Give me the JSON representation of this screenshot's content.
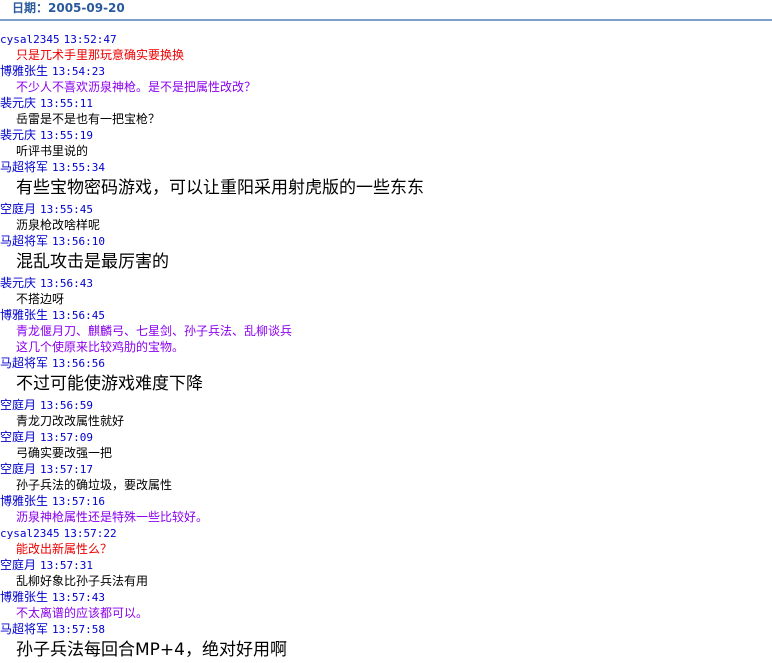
{
  "header": {
    "date_label": "日期：2005-09-20"
  },
  "colors": {
    "name": "#0000cc",
    "red": "#ee0000",
    "purple": "#8a00ee",
    "black": "#000000",
    "blue": "#0000ee"
  },
  "messages": [
    {
      "user": "cysal2345",
      "time": "13:52:47",
      "style": "red",
      "lines": [
        "只是兀术手里那玩意确实要换换"
      ]
    },
    {
      "user": "博雅张生",
      "time": "13:54:23",
      "style": "purple",
      "lines": [
        "不少人不喜欢沥泉神枪。是不是把属性改改？"
      ]
    },
    {
      "user": "裴元庆",
      "time": "13:55:11",
      "style": "black",
      "lines": [
        "岳雷是不是也有一把宝枪？"
      ]
    },
    {
      "user": "裴元庆",
      "time": "13:55:19",
      "style": "black",
      "lines": [
        "听评书里说的"
      ]
    },
    {
      "user": "马超将军",
      "time": "13:55:34",
      "style": "big",
      "lines": [
        "有些宝物密码游戏，可以让重阳采用射虎版的一些东东"
      ]
    },
    {
      "user": "空庭月",
      "time": "13:55:45",
      "style": "black",
      "lines": [
        "沥泉枪改啥样呢"
      ]
    },
    {
      "user": "马超将军",
      "time": "13:56:10",
      "style": "big",
      "lines": [
        "混乱攻击是最厉害的"
      ]
    },
    {
      "user": "裴元庆",
      "time": "13:56:43",
      "style": "black",
      "lines": [
        "不搭边呀"
      ]
    },
    {
      "user": "博雅张生",
      "time": "13:56:45",
      "style": "purple",
      "lines": [
        "青龙偃月刀、麒麟弓、七星剑、孙子兵法、乱柳谈兵",
        "这几个使原来比较鸡肋的宝物。"
      ]
    },
    {
      "user": "马超将军",
      "time": "13:56:56",
      "style": "big",
      "lines": [
        "不过可能使游戏难度下降"
      ]
    },
    {
      "user": "空庭月",
      "time": "13:56:59",
      "style": "black",
      "lines": [
        "青龙刀改改属性就好"
      ]
    },
    {
      "user": "空庭月",
      "time": "13:57:09",
      "style": "black",
      "lines": [
        "弓确实要改强一把"
      ]
    },
    {
      "user": "空庭月",
      "time": "13:57:17",
      "style": "black",
      "lines": [
        "孙子兵法的确垃圾，要改属性"
      ]
    },
    {
      "user": "博雅张生",
      "time": "13:57:16",
      "style": "purple",
      "lines": [
        "沥泉神枪属性还是特殊一些比较好。"
      ]
    },
    {
      "user": "cysal2345",
      "time": "13:57:22",
      "style": "red",
      "lines": [
        "能改出新属性么？"
      ]
    },
    {
      "user": "空庭月",
      "time": "13:57:31",
      "style": "black",
      "lines": [
        "乱柳好象比孙子兵法有用"
      ]
    },
    {
      "user": "博雅张生",
      "time": "13:57:43",
      "style": "purple",
      "lines": [
        "不太离谱的应该都可以。"
      ]
    },
    {
      "user": "马超将军",
      "time": "13:57:58",
      "style": "big",
      "lines": [
        "孙子兵法每回合MP+4，绝对好用啊"
      ]
    }
  ]
}
